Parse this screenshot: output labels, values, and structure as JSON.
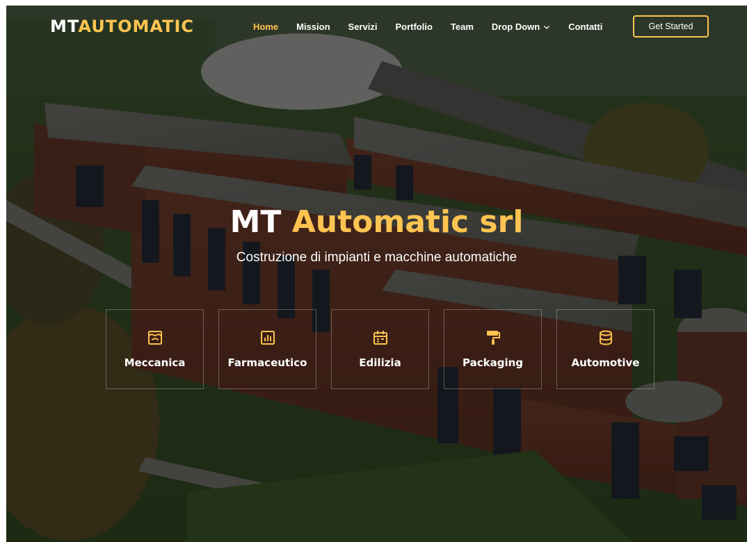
{
  "header": {
    "logo_part1": "MT",
    "logo_part2": "AUTOMATIC",
    "nav": [
      {
        "label": "Home",
        "active": true
      },
      {
        "label": "Mission",
        "active": false
      },
      {
        "label": "Servizi",
        "active": false
      },
      {
        "label": "Portfolio",
        "active": false
      },
      {
        "label": "Team",
        "active": false
      },
      {
        "label": "Drop Down",
        "active": false,
        "icon": "chevron-down-icon"
      },
      {
        "label": "Contatti",
        "active": false
      }
    ],
    "cta_label": "Get Started"
  },
  "hero": {
    "title_part1": "MT",
    "title_part2": "Automatic srl",
    "subtitle": "Costruzione di impianti e macchine automatiche"
  },
  "services": [
    {
      "label": "Meccanica",
      "icon": "store-icon"
    },
    {
      "label": "Farmaceutico",
      "icon": "bar-chart-icon"
    },
    {
      "label": "Edilizia",
      "icon": "calendar-icon"
    },
    {
      "label": "Packaging",
      "icon": "paint-roller-icon"
    },
    {
      "label": "Automotive",
      "icon": "database-icon"
    }
  ],
  "colors": {
    "accent": "#ffc451",
    "text": "#ffffff",
    "overlay": "rgba(0,0,0,0.52)"
  }
}
